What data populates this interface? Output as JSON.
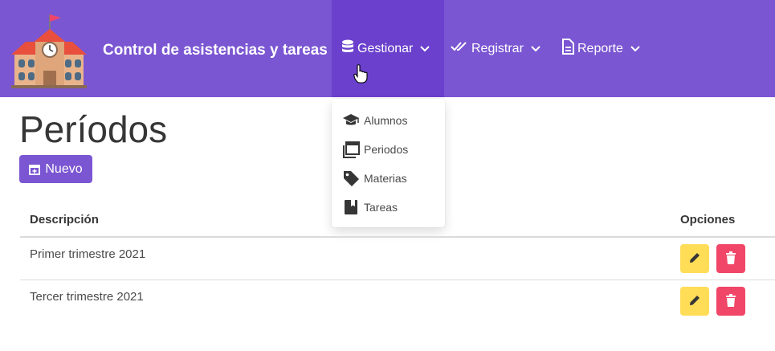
{
  "navbar": {
    "brand": "Control de asistencias y tareas",
    "menus": [
      {
        "label": "Gestionar",
        "icon": "database-icon",
        "active": true
      },
      {
        "label": "Registrar",
        "icon": "double-check-icon"
      },
      {
        "label": "Reporte",
        "icon": "file-document-icon"
      }
    ]
  },
  "dropdown": {
    "items": [
      {
        "label": "Alumnos",
        "icon": "graduation-cap-icon"
      },
      {
        "label": "Periodos",
        "icon": "calendar-multiple-icon"
      },
      {
        "label": "Materias",
        "icon": "tag-icon"
      },
      {
        "label": "Tareas",
        "icon": "notebook-icon"
      }
    ]
  },
  "page": {
    "title": "Períodos",
    "new_button": "Nuevo"
  },
  "table": {
    "headers": {
      "description": "Descripción",
      "options": "Opciones"
    },
    "rows": [
      {
        "description": "Primer trimestre 2021"
      },
      {
        "description": "Tercer trimestre 2021"
      }
    ]
  },
  "colors": {
    "primary": "#7b56d2",
    "primary_dark": "#6a40cc",
    "warning": "#ffdd57",
    "danger": "#f14668"
  }
}
